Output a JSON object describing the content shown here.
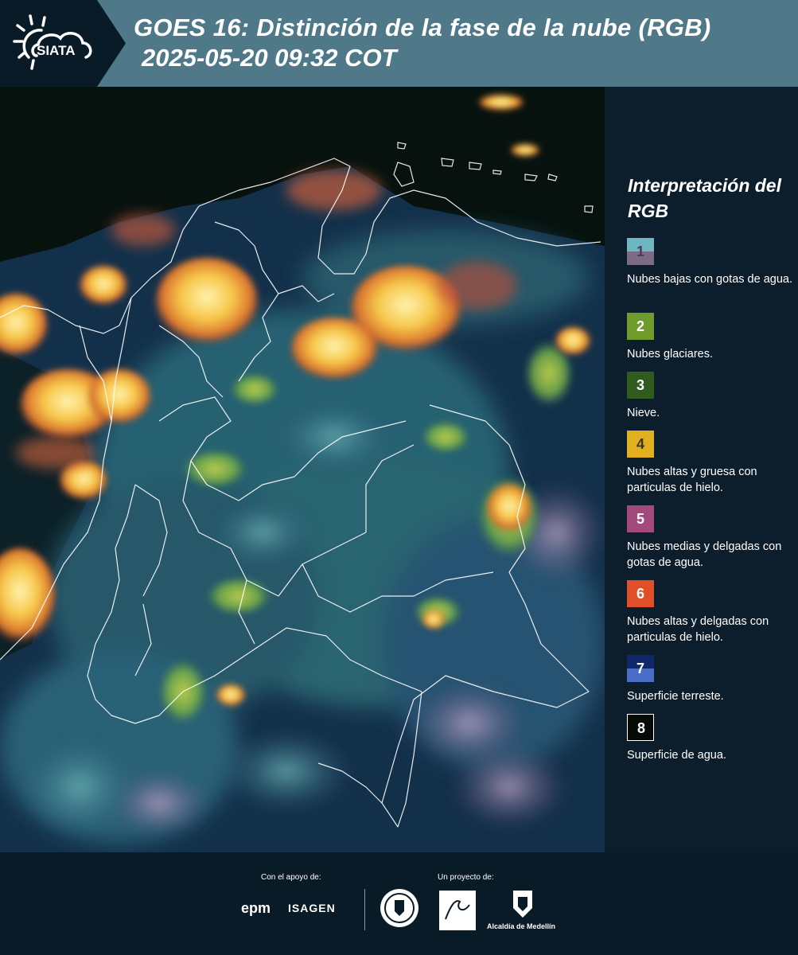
{
  "header": {
    "logo_text": "SIATA",
    "title": "GOES 16: Distinción de la fase de la nube (RGB)",
    "subtitle": "2025-05-20 09:32 COT"
  },
  "legend": {
    "title": "Interpretación del RGB",
    "items": [
      {
        "number": "1",
        "label": "Nubes bajas con gotas de agua.",
        "color_top": "#6fb6c3",
        "color_bottom": "#7d6a86",
        "number_color": "#4a3d50"
      },
      {
        "number": "2",
        "label": "Nubes glaciares.",
        "color_top": "#6f9a2c",
        "color_bottom": "#6f9a2c",
        "number_color": "#ffffff"
      },
      {
        "number": "3",
        "label": "Nieve.",
        "color_top": "#2f5c1e",
        "color_bottom": "#2f5c1e",
        "number_color": "#ffffff"
      },
      {
        "number": "4",
        "label": "Nubes altas y gruesa con particulas de hielo.",
        "color_top": "#e0b020",
        "color_bottom": "#e0b020",
        "number_color": "#3d3220"
      },
      {
        "number": "5",
        "label": "Nubes medias y delgadas con gotas de agua.",
        "color_top": "#a34a7c",
        "color_bottom": "#a34a7c",
        "number_color": "#ffffff"
      },
      {
        "number": "6",
        "label": "Nubes altas y delgadas con particulas de hielo.",
        "color_top": "#e04f2a",
        "color_bottom": "#e04f2a",
        "number_color": "#ffffff"
      },
      {
        "number": "7",
        "label": "Superficie terreste.",
        "color_top": "#10286a",
        "color_bottom": "#4a6ec8",
        "number_color": "#ffffff"
      },
      {
        "number": "8",
        "label": "Superficie de agua.",
        "color_top": "#050a07",
        "color_bottom": "#050a07",
        "number_color": "#ffffff",
        "border": "#ffffff"
      }
    ]
  },
  "footer": {
    "support_label": "Con el apoyo de:",
    "project_label": "Un proyecto de:",
    "sponsor_1": "epm",
    "sponsor_2": "ISAGEN",
    "partner_3": "Alcaldía de Medellín"
  }
}
